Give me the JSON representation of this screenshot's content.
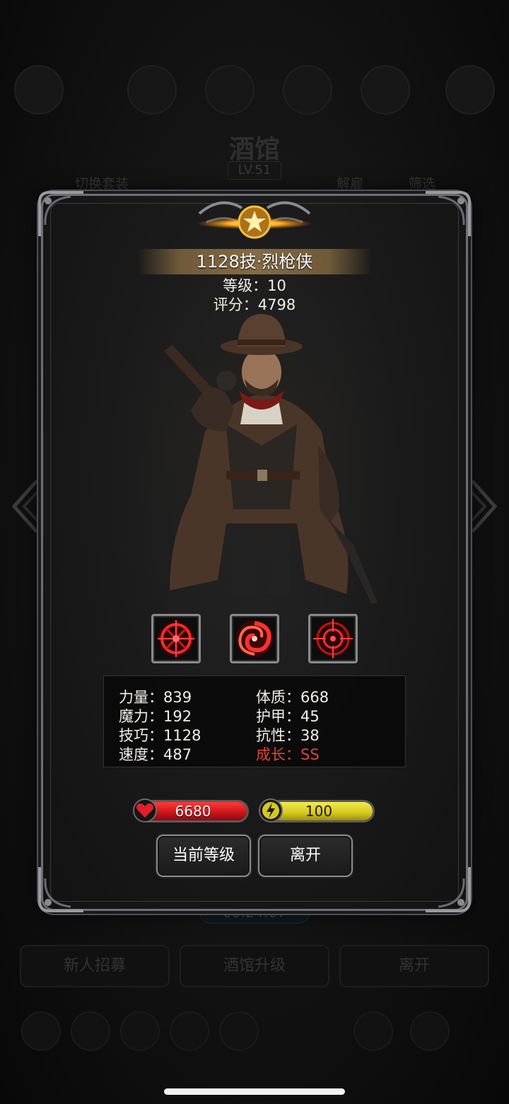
{
  "background": {
    "title": "酒馆",
    "level": "LV.51",
    "switch_outfit": "切换套装",
    "dismiss": "解雇",
    "filter": "筛选",
    "timer": "00:24:07",
    "buttons": [
      "新人招募",
      "酒馆升级",
      "离开"
    ]
  },
  "hero": {
    "name": "1128技·烈枪侠",
    "level_text": "等级：10",
    "score_text": "评分：4798",
    "skills": [
      "crosshair-skill-icon",
      "swirl-skill-icon",
      "target-skill-icon"
    ]
  },
  "stats": {
    "strength": "力量：839",
    "magic": "魔力：192",
    "skill": "技巧：1128",
    "speed": "速度：487",
    "constitution": "体质：668",
    "armor": "护甲：45",
    "resistance": "抗性：38",
    "growth": "成长：SS"
  },
  "bars": {
    "hp": "6680",
    "energy": "100"
  },
  "actions": {
    "current_level": "当前等级",
    "leave": "离开"
  },
  "colors": {
    "hp_fill": "#c8141a",
    "energy_fill": "#d6c81c",
    "growth_text": "#e0452e",
    "banner": "#8c7046"
  }
}
